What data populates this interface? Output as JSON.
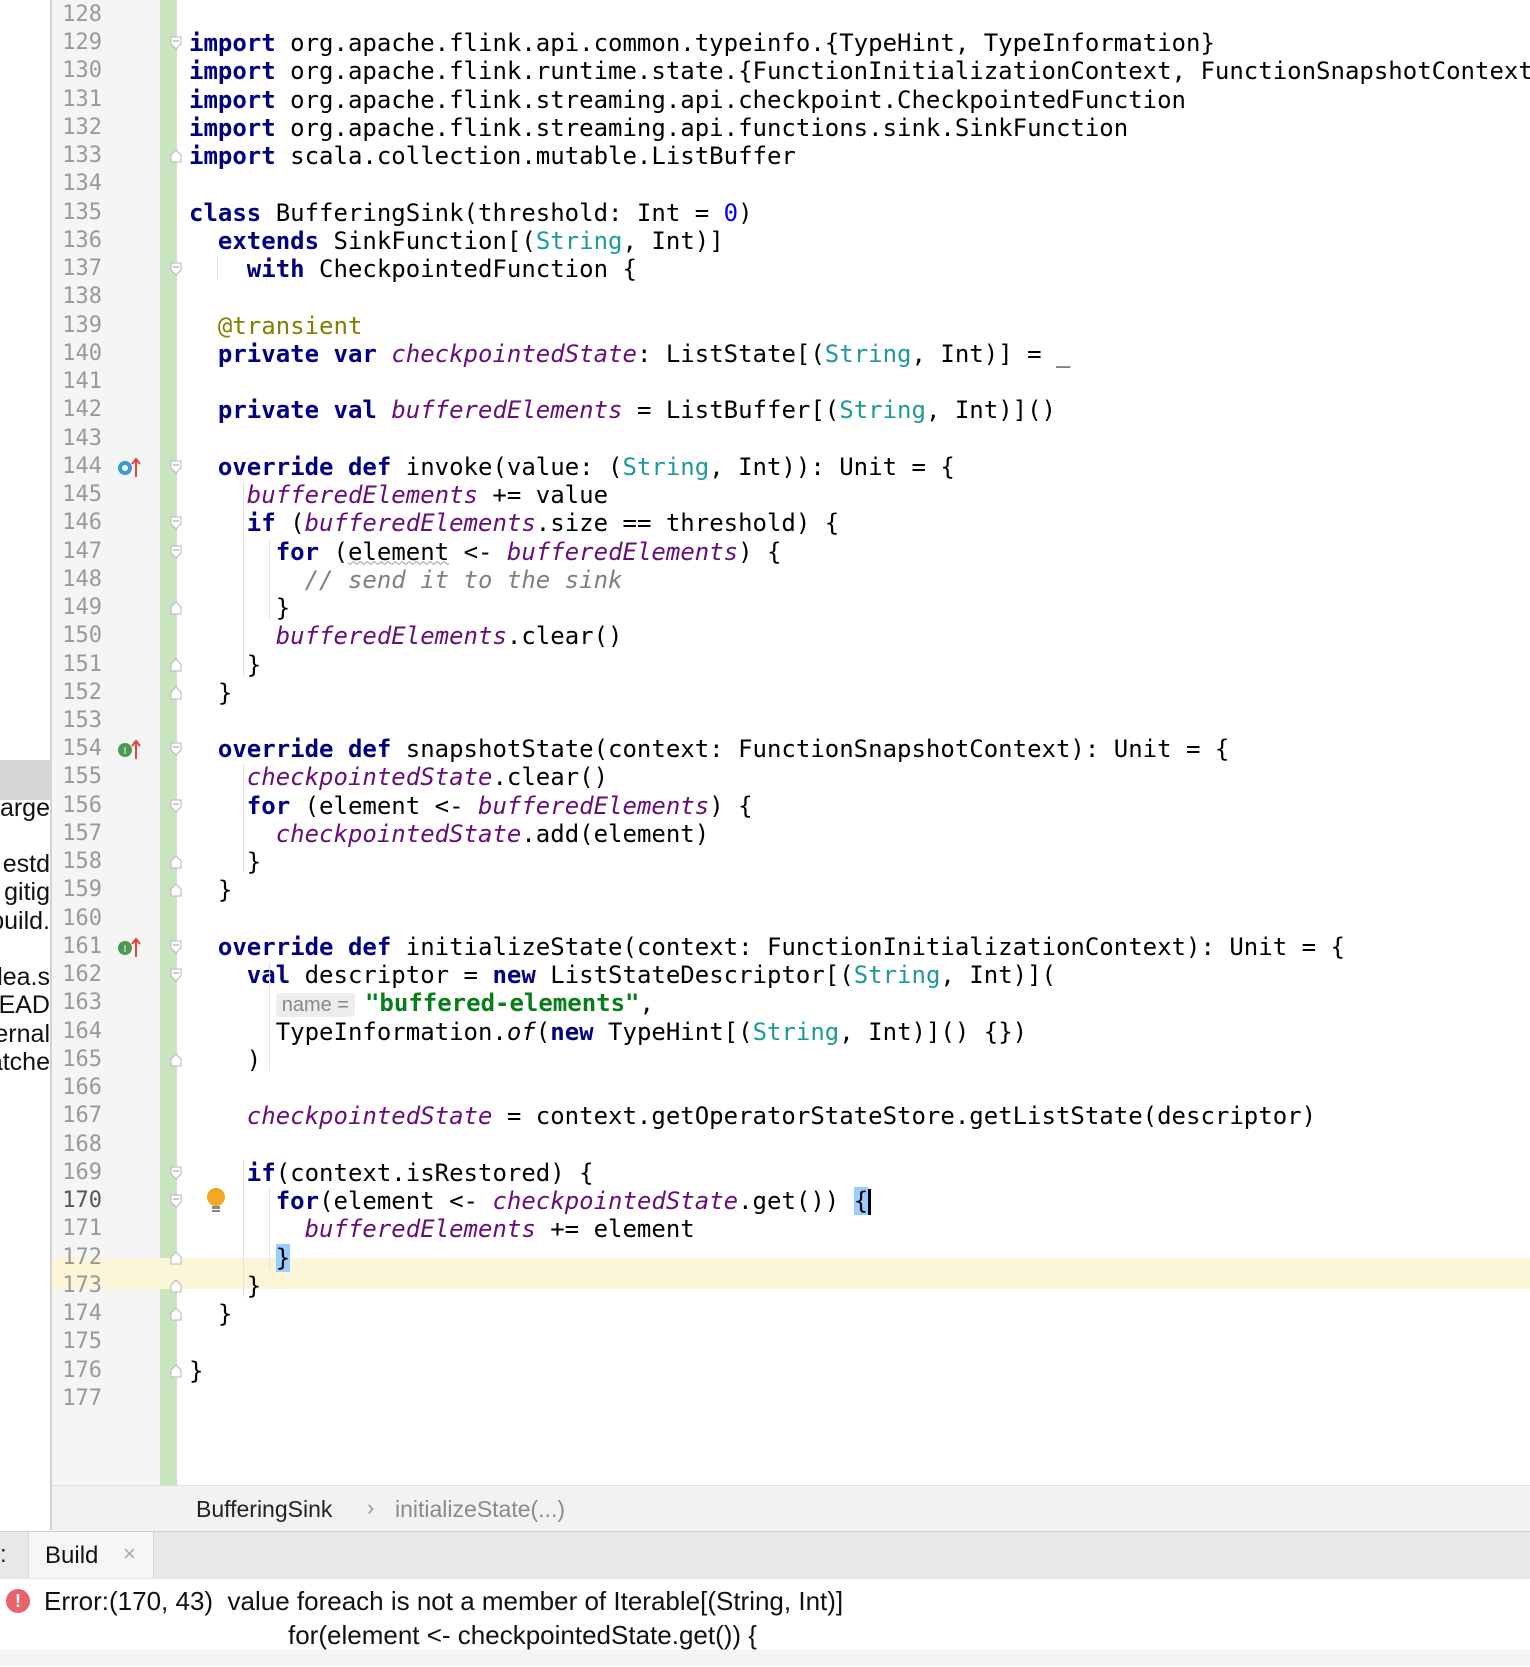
{
  "editor": {
    "current_line": 170,
    "lines": [
      {
        "n": 128,
        "html": ""
      },
      {
        "n": 129,
        "html": "<span class='kw'>import</span> org.apache.flink.api.common.typeinfo.{TypeHint, TypeInformation}"
      },
      {
        "n": 130,
        "html": "<span class='kw'>import</span> org.apache.flink.runtime.state.{FunctionInitializationContext, FunctionSnapshotContext}"
      },
      {
        "n": 131,
        "html": "<span class='kw'>import</span> org.apache.flink.streaming.api.checkpoint.CheckpointedFunction"
      },
      {
        "n": 132,
        "html": "<span class='kw'>import</span> org.apache.flink.streaming.api.functions.sink.SinkFunction"
      },
      {
        "n": 133,
        "html": "<span class='kw'>import</span> scala.collection.mutable.ListBuffer"
      },
      {
        "n": 134,
        "html": ""
      },
      {
        "n": 135,
        "html": "<span class='kw'>class</span> BufferingSink(threshold: Int = <span class='num'>0</span>)"
      },
      {
        "n": 136,
        "html": "  <span class='kw'>extends</span> SinkFunction[(<span class='ty'>String</span>, Int)]"
      },
      {
        "n": 137,
        "html": "    <span class='kw'>with</span> CheckpointedFunction {"
      },
      {
        "n": 138,
        "html": ""
      },
      {
        "n": 139,
        "html": "  <span class='ann'>@transient</span>"
      },
      {
        "n": 140,
        "html": "  <span class='kw'>private var</span> <span class='fld'>checkpointedState</span>: ListState[(<span class='ty'>String</span>, Int)] = _"
      },
      {
        "n": 141,
        "html": ""
      },
      {
        "n": 142,
        "html": "  <span class='kw'>private val</span> <span class='fld'>bufferedElements</span> = ListBuffer[(<span class='ty'>String</span>, Int)]()"
      },
      {
        "n": 143,
        "html": ""
      },
      {
        "n": 144,
        "html": "  <span class='kw'>override def</span> invoke(value: (<span class='ty'>String</span>, Int)): Unit = {"
      },
      {
        "n": 145,
        "html": "    <span class='fld'>bufferedElements</span> += value"
      },
      {
        "n": 146,
        "html": "    <span class='kw'>if</span> (<span class='fld'>bufferedElements</span>.size == threshold) {"
      },
      {
        "n": 147,
        "html": "      <span class='kw'>for</span> (<span class='squig'>element</span> &lt;- <span class='fld'>bufferedElements</span>) {"
      },
      {
        "n": 148,
        "html": "        <span class='cmt'>// send it to the sink</span>"
      },
      {
        "n": 149,
        "html": "      }"
      },
      {
        "n": 150,
        "html": "      <span class='fld'>bufferedElements</span>.clear()"
      },
      {
        "n": 151,
        "html": "    }"
      },
      {
        "n": 152,
        "html": "  }"
      },
      {
        "n": 153,
        "html": ""
      },
      {
        "n": 154,
        "html": "  <span class='kw'>override def</span> snapshotState(context: FunctionSnapshotContext): Unit = {"
      },
      {
        "n": 155,
        "html": "    <span class='fld'>checkpointedState</span>.clear()"
      },
      {
        "n": 156,
        "html": "    <span class='kw'>for</span> (element &lt;- <span class='fld'>bufferedElements</span>) {"
      },
      {
        "n": 157,
        "html": "      <span class='fld'>checkpointedState</span>.add(element)"
      },
      {
        "n": 158,
        "html": "    }"
      },
      {
        "n": 159,
        "html": "  }"
      },
      {
        "n": 160,
        "html": ""
      },
      {
        "n": 161,
        "html": "  <span class='kw'>override def</span> initializeState(context: FunctionInitializationContext): Unit = {"
      },
      {
        "n": 162,
        "html": "    <span class='kw'>val</span> descriptor = <span class='kw'>new</span> ListStateDescriptor[(<span class='ty'>String</span>, Int)]("
      },
      {
        "n": 163,
        "html": "      <span class='hint'>name =</span><span class='str'>\"buffered-elements\"</span>,"
      },
      {
        "n": 164,
        "html": "      TypeInformation.<span class='ital'>of</span>(<span class='kw'>new</span> TypeHint[(<span class='ty'>String</span>, Int)]() {})"
      },
      {
        "n": 165,
        "html": "    )"
      },
      {
        "n": 166,
        "html": ""
      },
      {
        "n": 167,
        "html": "    <span class='fld'>checkpointedState</span> = context.getOperatorStateStore.getListState(descriptor)"
      },
      {
        "n": 168,
        "html": ""
      },
      {
        "n": 169,
        "html": "    <span class='kw'>if</span>(context.isRestored) {"
      },
      {
        "n": 170,
        "html": "      <span class='kw'>for</span>(element &lt;- <span class='fld'>checkpointedState</span>.get()) <span class='brace-hl'>{</span><span class='caret'></span>"
      },
      {
        "n": 171,
        "html": "        <span class='fld'>bufferedElements</span> += element"
      },
      {
        "n": 172,
        "html": "      <span class='brace-hl'>}</span>"
      },
      {
        "n": 173,
        "html": "    }"
      },
      {
        "n": 174,
        "html": "  }"
      },
      {
        "n": 175,
        "html": ""
      },
      {
        "n": 176,
        "html": "}"
      },
      {
        "n": 177,
        "html": ""
      }
    ]
  },
  "project_panel": {
    "items": [
      {
        "label": "arge",
        "line": 156
      },
      {
        "label": "estd",
        "line": 158
      },
      {
        "label": "gitig",
        "line": 159
      },
      {
        "label": "build.",
        "line": 160
      },
      {
        "label": "dea.s",
        "line": 162
      },
      {
        "label": "READ",
        "line": 163
      },
      {
        "label": "ernal",
        "line": 164
      },
      {
        "label": "atche",
        "line": 165
      }
    ]
  },
  "breadcrumb": {
    "class_name": "BufferingSink",
    "separator": "›",
    "method_name": "initializeState(...)"
  },
  "tool_window": {
    "left_glyph": ":",
    "tab_label": "Build",
    "close_glyph": "×"
  },
  "build_output": {
    "icon_glyph": "!",
    "error_message": "Error:(170, 43)  value foreach is not a member of Iterable[(String, Int)]",
    "error_code_line": "for(element <- checkpointedState.get()) {"
  },
  "colors": {
    "keyword": "#000080",
    "field": "#660e7a",
    "type": "#20999d",
    "number": "#0000ff",
    "string": "#067d17",
    "annotation": "#808000",
    "comment": "#808080",
    "current_line_bg": "#fcf6d8",
    "vcs_added": "#c9e5c0",
    "error": "#e8646a"
  },
  "gutter_icons": [
    {
      "line": 144,
      "icon": "overrides-method-icon"
    },
    {
      "line": 154,
      "icon": "implements-method-icon"
    },
    {
      "line": 161,
      "icon": "implements-method-icon"
    },
    {
      "line": 170,
      "icon": "intention-bulb-icon"
    }
  ]
}
